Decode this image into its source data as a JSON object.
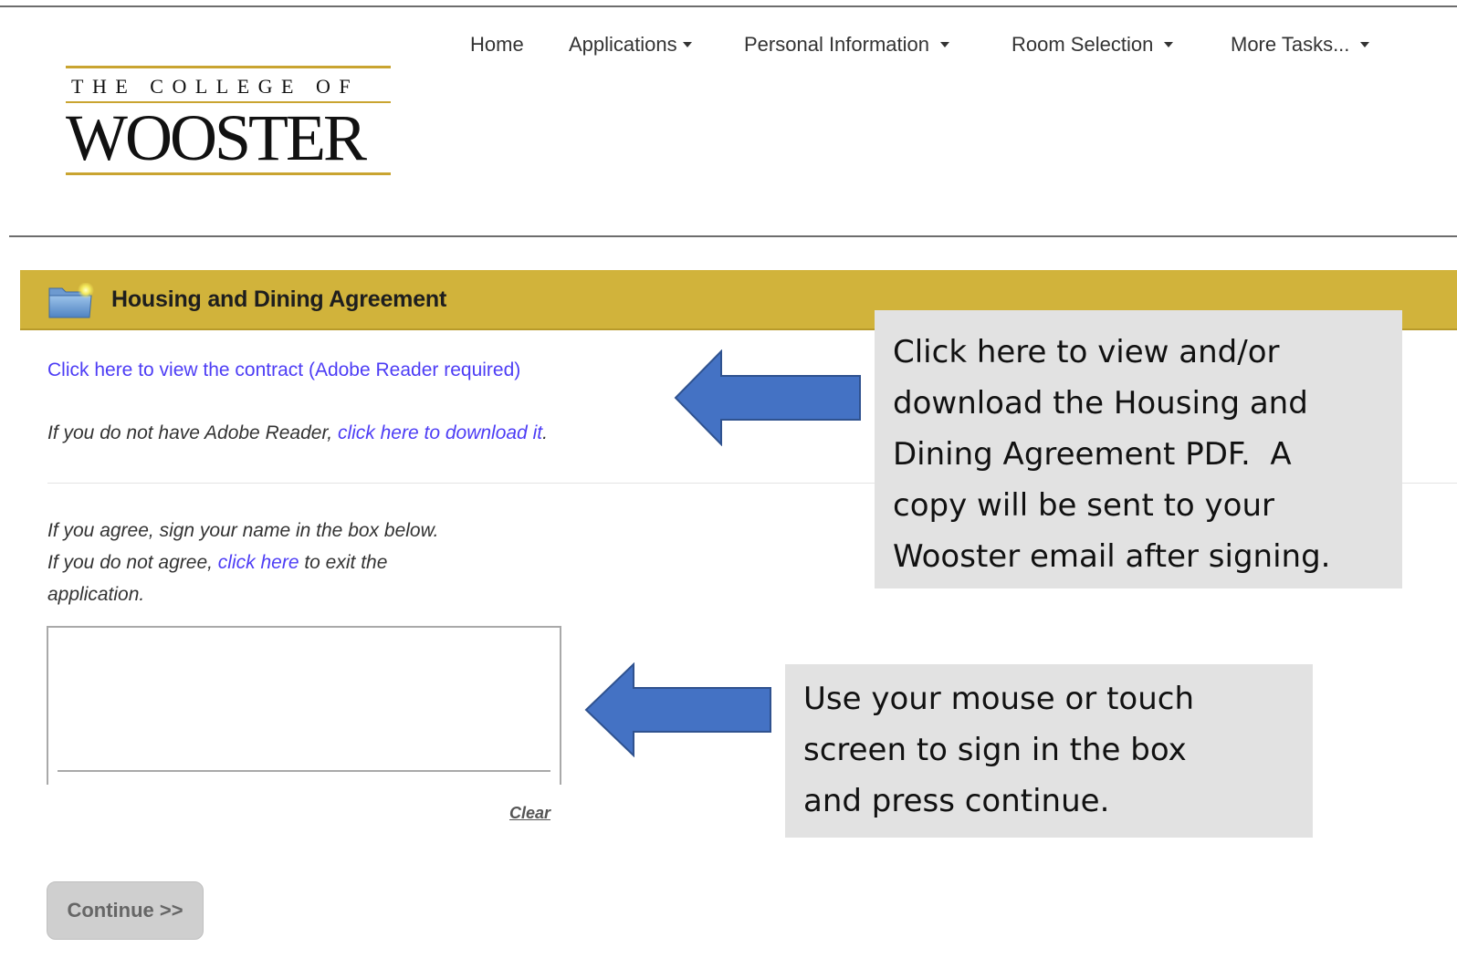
{
  "logo": {
    "line1": "THE COLLEGE OF",
    "line2": "WOOSTER"
  },
  "nav": {
    "home": "Home",
    "applications": "Applications",
    "personal_information": "Personal Information",
    "room_selection": "Room Selection",
    "more_tasks": "More Tasks..."
  },
  "panel": {
    "title": "Housing and Dining Agreement",
    "icon": "folder-icon"
  },
  "content": {
    "contract_link": "Click here to view the contract (Adobe Reader required)",
    "adobe_prefix": "If you do not have Adobe Reader, ",
    "adobe_link": "click here to download it",
    "adobe_suffix": ".",
    "agree_line1": "If you agree, sign your name in the box below.",
    "agree_line2_prefix": "If you do not agree, ",
    "agree_line2_link": "click here",
    "agree_line2_suffix": " to exit the",
    "agree_line3": "application.",
    "clear_link": "Clear",
    "continue_button": "Continue >>"
  },
  "callouts": {
    "contract": {
      "line1": "Click here to view and/or",
      "line2": "download the Housing and",
      "line3": "Dining Agreement PDF.  A",
      "line4": "copy will be sent to your",
      "line5": "Wooster email after signing."
    },
    "signature": {
      "line1": "Use your mouse or touch",
      "line2": "screen to sign in the box",
      "line3": "and press continue."
    }
  },
  "colors": {
    "header_gold": "#d1b33b",
    "link_blue": "#4d3df5",
    "arrow_blue": "#4472c4",
    "callout_gray": "#e2e2e2"
  }
}
